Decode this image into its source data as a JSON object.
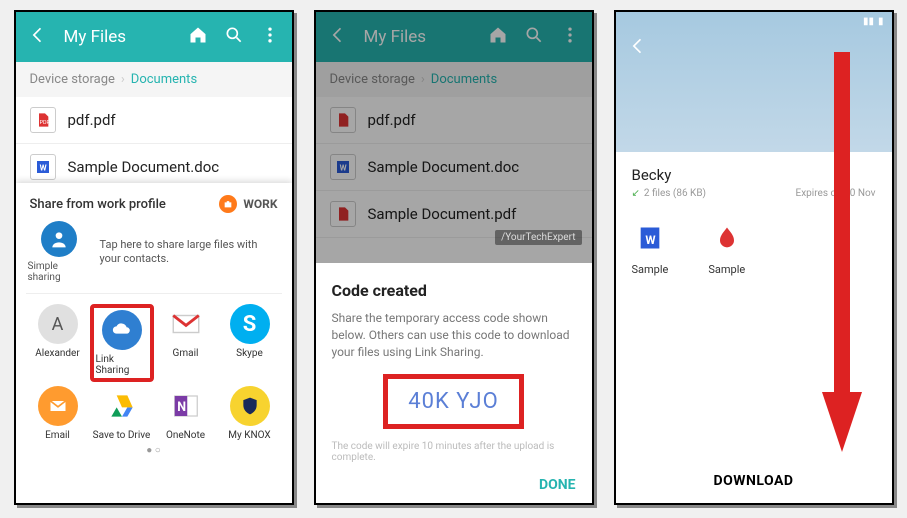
{
  "phone1": {
    "title": "My Files",
    "breadcrumb": {
      "root": "Device storage",
      "current": "Documents"
    },
    "files": [
      {
        "name": "pdf.pdf",
        "type": "pdf"
      },
      {
        "name": "Sample Document.doc",
        "type": "doc"
      }
    ],
    "share": {
      "header": "Share from work profile",
      "work_label": "WORK",
      "simple_sharing_text": "Tap here to share large files with your contacts.",
      "simple_sharing_label": "Simple sharing",
      "targets_row1": [
        {
          "label": "Alexander"
        },
        {
          "label": "Link Sharing"
        },
        {
          "label": "Gmail"
        },
        {
          "label": "Skype"
        }
      ],
      "targets_row2": [
        {
          "label": "Email"
        },
        {
          "label": "Save to Drive"
        },
        {
          "label": "OneNote"
        },
        {
          "label": "My KNOX"
        }
      ]
    }
  },
  "phone2": {
    "title": "My Files",
    "breadcrumb": {
      "root": "Device storage",
      "current": "Documents"
    },
    "files": [
      {
        "name": "pdf.pdf",
        "type": "pdf"
      },
      {
        "name": "Sample Document.doc",
        "type": "doc"
      },
      {
        "name": "Sample Document.pdf",
        "type": "pdf"
      }
    ],
    "watermark": "/YourTechExpert",
    "dialog": {
      "title": "Code created",
      "desc": "Share the temporary access code shown below. Others can use this code to download your files using Link Sharing.",
      "code": "40K YJO",
      "expire": "The code will expire 10 minutes after the upload is complete.",
      "done": "DONE"
    }
  },
  "phone3": {
    "sender": "Becky",
    "summary": "2 files (86 KB)",
    "expires": "Expires on 10 Nov",
    "files": [
      {
        "name": "Sample",
        "type": "doc"
      },
      {
        "name": "Sample",
        "type": "pdf"
      }
    ],
    "download": "DOWNLOAD"
  }
}
